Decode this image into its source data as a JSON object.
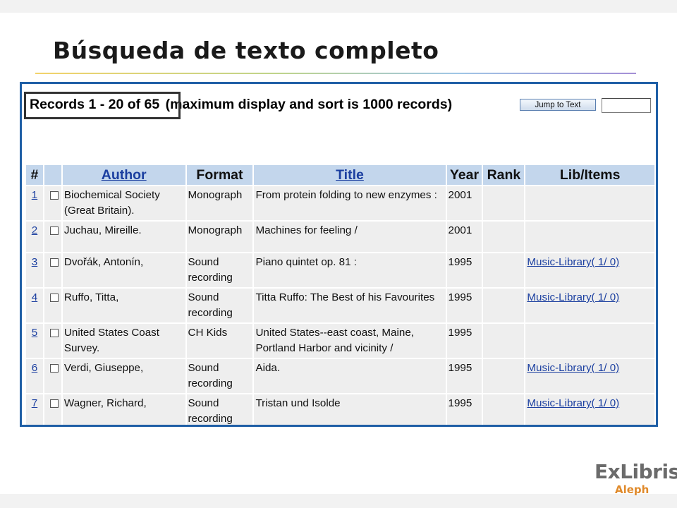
{
  "slide": {
    "title": "Búsqueda de texto completo"
  },
  "header": {
    "records_count": "Records 1 - 20 of 65",
    "records_note": "(maximum display and sort is 1000 records)",
    "jump_button_label": "Jump to Text",
    "jump_input_value": ""
  },
  "table": {
    "columns": [
      "#",
      "",
      "Author",
      "Format",
      "Title",
      "Year",
      "Rank",
      "Lib/Items"
    ],
    "rows": [
      {
        "num": "1",
        "author": "Biochemical Society (Great Britain).",
        "format": "Monograph",
        "title": "From protein folding to new enzymes :",
        "year": "2001",
        "rank": "",
        "lib": ""
      },
      {
        "num": "2",
        "author": "Juchau, Mireille.",
        "format": "Monograph",
        "title": "Machines for feeling /",
        "year": "2001",
        "rank": "",
        "lib": ""
      },
      {
        "num": "3",
        "author": "Dvořák, Antonín,",
        "format": "Sound recording",
        "title": "Piano quintet op. 81 :",
        "year": "1995",
        "rank": "",
        "lib": "Music-Library( 1/ 0)"
      },
      {
        "num": "4",
        "author": "Ruffo, Titta,",
        "format": "Sound recording",
        "title": "Titta Ruffo: The Best of his Favourites",
        "year": "1995",
        "rank": "",
        "lib": "Music-Library( 1/ 0)"
      },
      {
        "num": "5",
        "author": "United States Coast Survey.",
        "format": "CH Kids",
        "title": "United States--east coast, Maine, Portland Harbor and vicinity /",
        "year": "1995",
        "rank": "",
        "lib": ""
      },
      {
        "num": "6",
        "author": "Verdi, Giuseppe,",
        "format": "Sound recording",
        "title": "Aida.",
        "year": "1995",
        "rank": "",
        "lib": "Music-Library( 1/ 0)"
      },
      {
        "num": "7",
        "author": "Wagner, Richard,",
        "format": "Sound recording",
        "title": "Tristan und Isolde",
        "year": "1995",
        "rank": "",
        "lib": "Music-Library( 1/ 0)"
      }
    ]
  },
  "logo": {
    "main": "ExLibris",
    "sub": "Aleph"
  },
  "colors": {
    "frame_border": "#1f5fa6",
    "header_cell": "#c3d6ec",
    "body_cell": "#eeeeee",
    "link": "#1b3fa0",
    "logo_sub": "#e08a2b"
  }
}
